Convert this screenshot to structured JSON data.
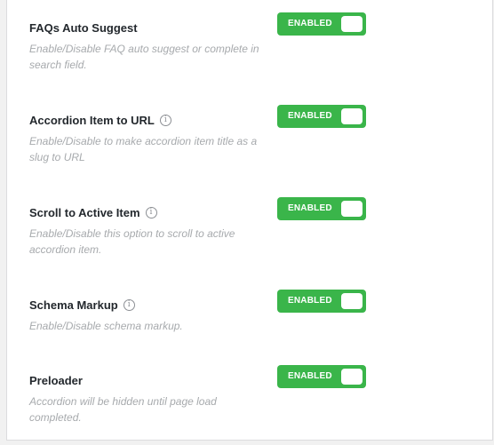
{
  "settings": [
    {
      "title": "FAQs Auto Suggest",
      "has_info": false,
      "description": "Enable/Disable FAQ auto suggest or complete in search field.",
      "toggle_label": "ENABLED"
    },
    {
      "title": "Accordion Item to URL",
      "has_info": true,
      "description": "Enable/Disable to make accordion item title as a slug to URL",
      "toggle_label": "ENABLED"
    },
    {
      "title": "Scroll to Active Item",
      "has_info": true,
      "description": "Enable/Disable this option to scroll to active accordion item.",
      "toggle_label": "ENABLED"
    },
    {
      "title": "Schema Markup",
      "has_info": true,
      "description": "Enable/Disable schema markup.",
      "toggle_label": "ENABLED"
    },
    {
      "title": "Preloader",
      "has_info": false,
      "description": "Accordion will be hidden until page load completed.",
      "toggle_label": "ENABLED"
    }
  ],
  "info_icon_glyph": "i",
  "colors": {
    "toggle_on": "#3ab54a",
    "description": "#a7aaad",
    "title": "#23282d"
  }
}
